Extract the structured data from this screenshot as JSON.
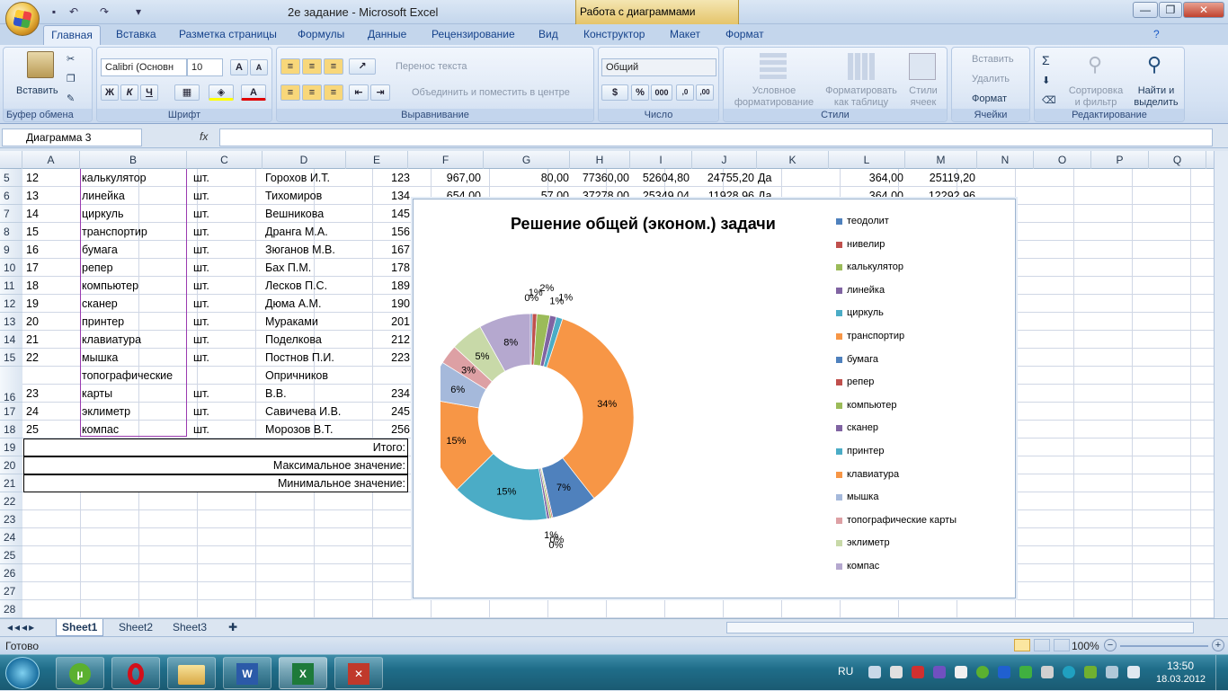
{
  "window": {
    "title": "2e задание - Microsoft Excel",
    "context_tab": "Работа с диаграммами",
    "minimize": "—",
    "restore": "❐",
    "close": "✕"
  },
  "ribbon_tabs": [
    "Главная",
    "Вставка",
    "Разметка страницы",
    "Формулы",
    "Данные",
    "Рецензирование",
    "Вид",
    "Конструктор",
    "Макет",
    "Формат"
  ],
  "ribbon": {
    "clipboard": {
      "paste": "Вставить",
      "label": "Буфер обмена"
    },
    "font": {
      "name": "Calibri (Основн",
      "size": "10",
      "bold": "Ж",
      "italic": "К",
      "underline": "Ч",
      "label": "Шрифт"
    },
    "align": {
      "wrap": "Перенос текста",
      "merge": "Объединить и поместить в центре",
      "label": "Выравнивание"
    },
    "number": {
      "format": "Общий",
      "percent": "%",
      "thousands": "000",
      "label": "Число"
    },
    "styles": {
      "cond": "Условное форматирование",
      "table": "Форматировать как таблицу",
      "cell": "Стили ячеек",
      "label": "Стили"
    },
    "cells": {
      "insert": "Вставить",
      "delete": "Удалить",
      "format": "Формат",
      "label": "Ячейки"
    },
    "edit": {
      "sort": "Сортировка и фильтр",
      "find": "Найти и выделить",
      "label": "Редактирование"
    }
  },
  "namebox": "Диаграмма 3",
  "fx": "fx",
  "columns": [
    "A",
    "B",
    "C",
    "D",
    "E",
    "F",
    "G",
    "H",
    "I",
    "J",
    "K",
    "L",
    "M",
    "N",
    "O",
    "P",
    "Q"
  ],
  "row_numbers": [
    "5",
    "6",
    "7",
    "8",
    "9",
    "10",
    "11",
    "12",
    "13",
    "14",
    "15",
    "16",
    "17",
    "18",
    "19",
    "20",
    "21",
    "22",
    "23",
    "24",
    "25",
    "26",
    "27",
    "28"
  ],
  "rows": [
    {
      "a": "12",
      "b": "калькулятор",
      "c": "шт.",
      "d": "Горохов И.Т.",
      "e": "123",
      "f": "967,00",
      "g": "80,00",
      "h": "77360,00",
      "i": "52604,80",
      "j": "24755,20",
      "k": "Да",
      "l": "364,00",
      "m": "25119,20"
    },
    {
      "a": "13",
      "b": "линейка",
      "c": "шт.",
      "d": "Тихомиров",
      "e": "134",
      "f": "654,00",
      "g": "57,00",
      "h": "37278,00",
      "i": "25349,04",
      "j": "11928,96",
      "k": "Да",
      "l": "364,00",
      "m": "12292,96"
    },
    {
      "a": "14",
      "b": "циркуль",
      "c": "шт.",
      "d": "Вешникова",
      "e": "145"
    },
    {
      "a": "15",
      "b": "транспортир",
      "c": "шт.",
      "d": "Дранга М.А.",
      "e": "156"
    },
    {
      "a": "16",
      "b": "бумага",
      "c": "шт.",
      "d": "Зюганов М.В.",
      "e": "167"
    },
    {
      "a": "17",
      "b": "репер",
      "c": "шт.",
      "d": "Бах П.М.",
      "e": "178"
    },
    {
      "a": "18",
      "b": "компьютер",
      "c": "шт.",
      "d": "Лесков П.С.",
      "e": "189"
    },
    {
      "a": "19",
      "b": "сканер",
      "c": "шт.",
      "d": "Дюма А.М.",
      "e": "190"
    },
    {
      "a": "20",
      "b": "принтер",
      "c": "шт.",
      "d": "Мураками",
      "e": "201"
    },
    {
      "a": "21",
      "b": "клавиатура",
      "c": "шт.",
      "d": "Поделкова",
      "e": "212"
    },
    {
      "a": "22",
      "b": "мышка",
      "c": "шт.",
      "d": "Постнов П.И.",
      "e": "223"
    },
    {
      "a": "23",
      "b1": "топографические",
      "b2": "карты",
      "c": "шт.",
      "d1": "Опричников",
      "d2": "В.В.",
      "e": "234"
    },
    {
      "a": "24",
      "b": "эклиметр",
      "c": "шт.",
      "d": "Савичева И.В.",
      "e": "245"
    },
    {
      "a": "25",
      "b": "компас",
      "c": "шт.",
      "d": "Морозов В.Т.",
      "e": "256"
    }
  ],
  "totals": [
    "Итого:",
    "Максимальное значение:",
    "Минимальное значение:"
  ],
  "sheets": [
    "Sheet1",
    "Sheet2",
    "Sheet3"
  ],
  "status": {
    "ready": "Готово",
    "zoom": "100%"
  },
  "taskbar": {
    "lang": "RU",
    "time": "13:50",
    "date": "18.03.2012"
  },
  "chart_data": {
    "type": "pie",
    "title": "Решение общей (эконом.) задачи",
    "labels": [
      "теодолит",
      "нивелир",
      "калькулятор",
      "линейка",
      "циркуль",
      "транспортир",
      "бумага",
      "репер",
      "компьютер",
      "сканер",
      "принтер",
      "клавиатура",
      "мышка",
      "топографические карты",
      "эклиметр",
      "компас"
    ],
    "values": [
      0.3,
      0.7,
      2,
      1,
      1,
      34,
      7,
      0.2,
      0.3,
      0.4,
      15,
      15,
      6,
      3,
      5,
      8
    ],
    "data_labels": [
      "0%",
      "1%",
      "2%",
      "1%",
      "1%",
      "34%",
      "7%",
      "0%",
      "0%",
      "1%",
      "15%",
      "15%",
      "6%",
      "3%",
      "5%",
      "8%"
    ],
    "colors": [
      "#4F81BD",
      "#C0504D",
      "#9BBB59",
      "#8064A2",
      "#4BACC6",
      "#F79646",
      "#4F81BD",
      "#C0504D",
      "#9BBB59",
      "#8064A2",
      "#4BACC6",
      "#F79646",
      "#A5B9DB",
      "#DDA0A4",
      "#C8D9A8",
      "#B5A8CF"
    ],
    "legend": "right",
    "hole": "doughnut"
  }
}
